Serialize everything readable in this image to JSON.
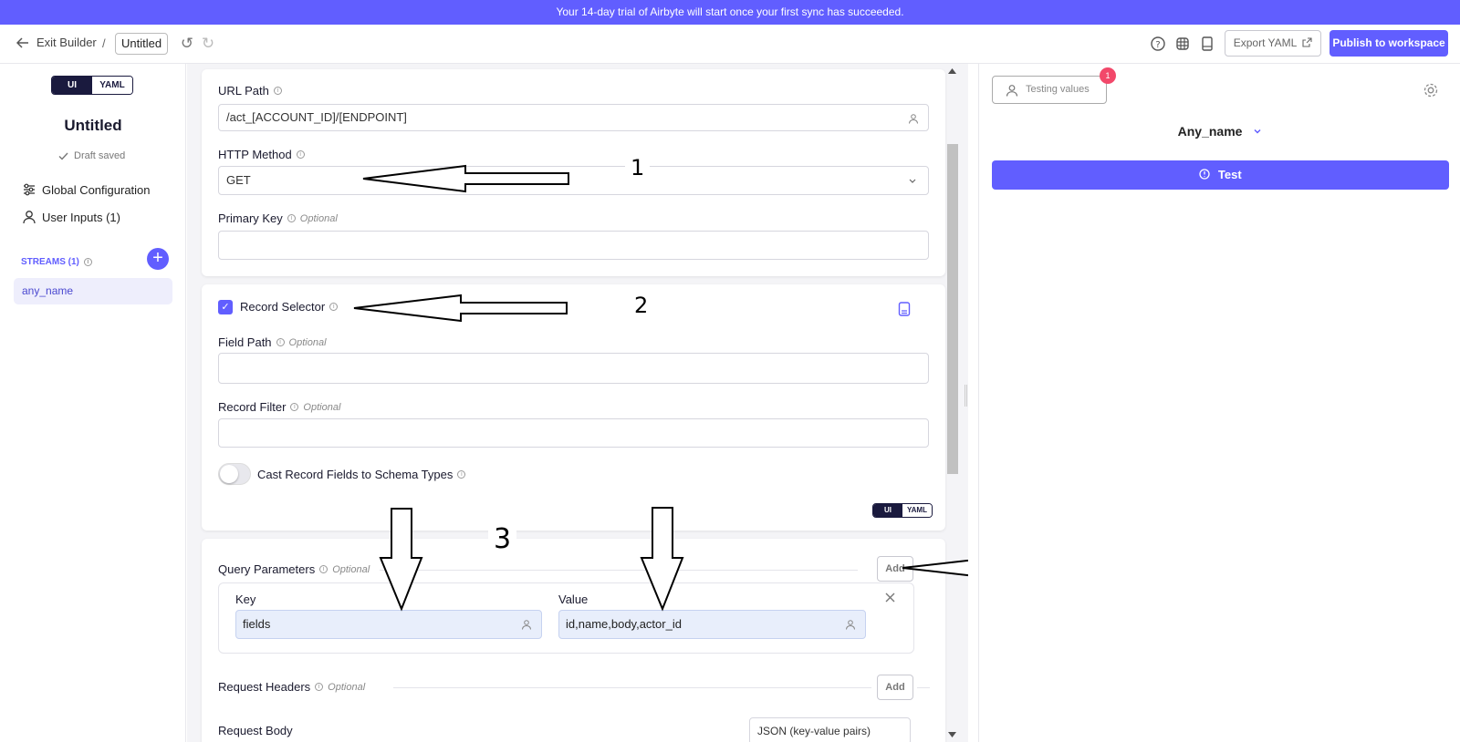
{
  "banner": {
    "text": "Your 14-day trial of Airbyte will start once your first sync has succeeded."
  },
  "topbar": {
    "exit_label": "Exit Builder",
    "separator": "/",
    "title": "Untitled",
    "export_label": "Export YAML",
    "publish_label": "Publish to workspace"
  },
  "sidebar": {
    "toggle": {
      "ui": "UI",
      "yaml": "YAML"
    },
    "connector_name": "Untitled",
    "draft_status": "Draft saved",
    "global_config": "Global Configuration",
    "user_inputs": "User Inputs (1)",
    "streams_label": "STREAMS (1)",
    "add_symbol": "+",
    "streams": [
      "any_name"
    ]
  },
  "main": {
    "url_path": {
      "label": "URL Path",
      "value": "/act_[ACCOUNT_ID]/[ENDPOINT]"
    },
    "http_method": {
      "label": "HTTP Method",
      "value": "GET"
    },
    "primary_key": {
      "label": "Primary Key",
      "optional": "Optional",
      "value": ""
    },
    "record_selector": {
      "label": "Record Selector",
      "checked": true,
      "field_path": {
        "label": "Field Path",
        "optional": "Optional",
        "value": ""
      },
      "record_filter": {
        "label": "Record Filter",
        "optional": "Optional",
        "value": ""
      },
      "cast_label": "Cast Record Fields to Schema Types",
      "cast_enabled": false,
      "toggle": {
        "ui": "UI",
        "yaml": "YAML"
      }
    },
    "query_params": {
      "label": "Query Parameters",
      "optional": "Optional",
      "add_label": "Add",
      "key_header": "Key",
      "value_header": "Value",
      "rows": [
        {
          "key": "fields",
          "value": "id,name,body,actor_id"
        }
      ]
    },
    "request_headers": {
      "label": "Request Headers",
      "optional": "Optional",
      "add_label": "Add"
    },
    "request_body": {
      "label": "Request Body",
      "value": "JSON (key-value pairs)"
    }
  },
  "right_panel": {
    "testing_values_label": "Testing values",
    "badge_count": "1",
    "stream_name": "Any_name",
    "test_label": "Test"
  },
  "annotations": {
    "one": "1",
    "two": "2",
    "three": "3"
  },
  "colors": {
    "accent": "#615eff",
    "badge": "#f2486a",
    "dark": "#1a1a3e"
  }
}
